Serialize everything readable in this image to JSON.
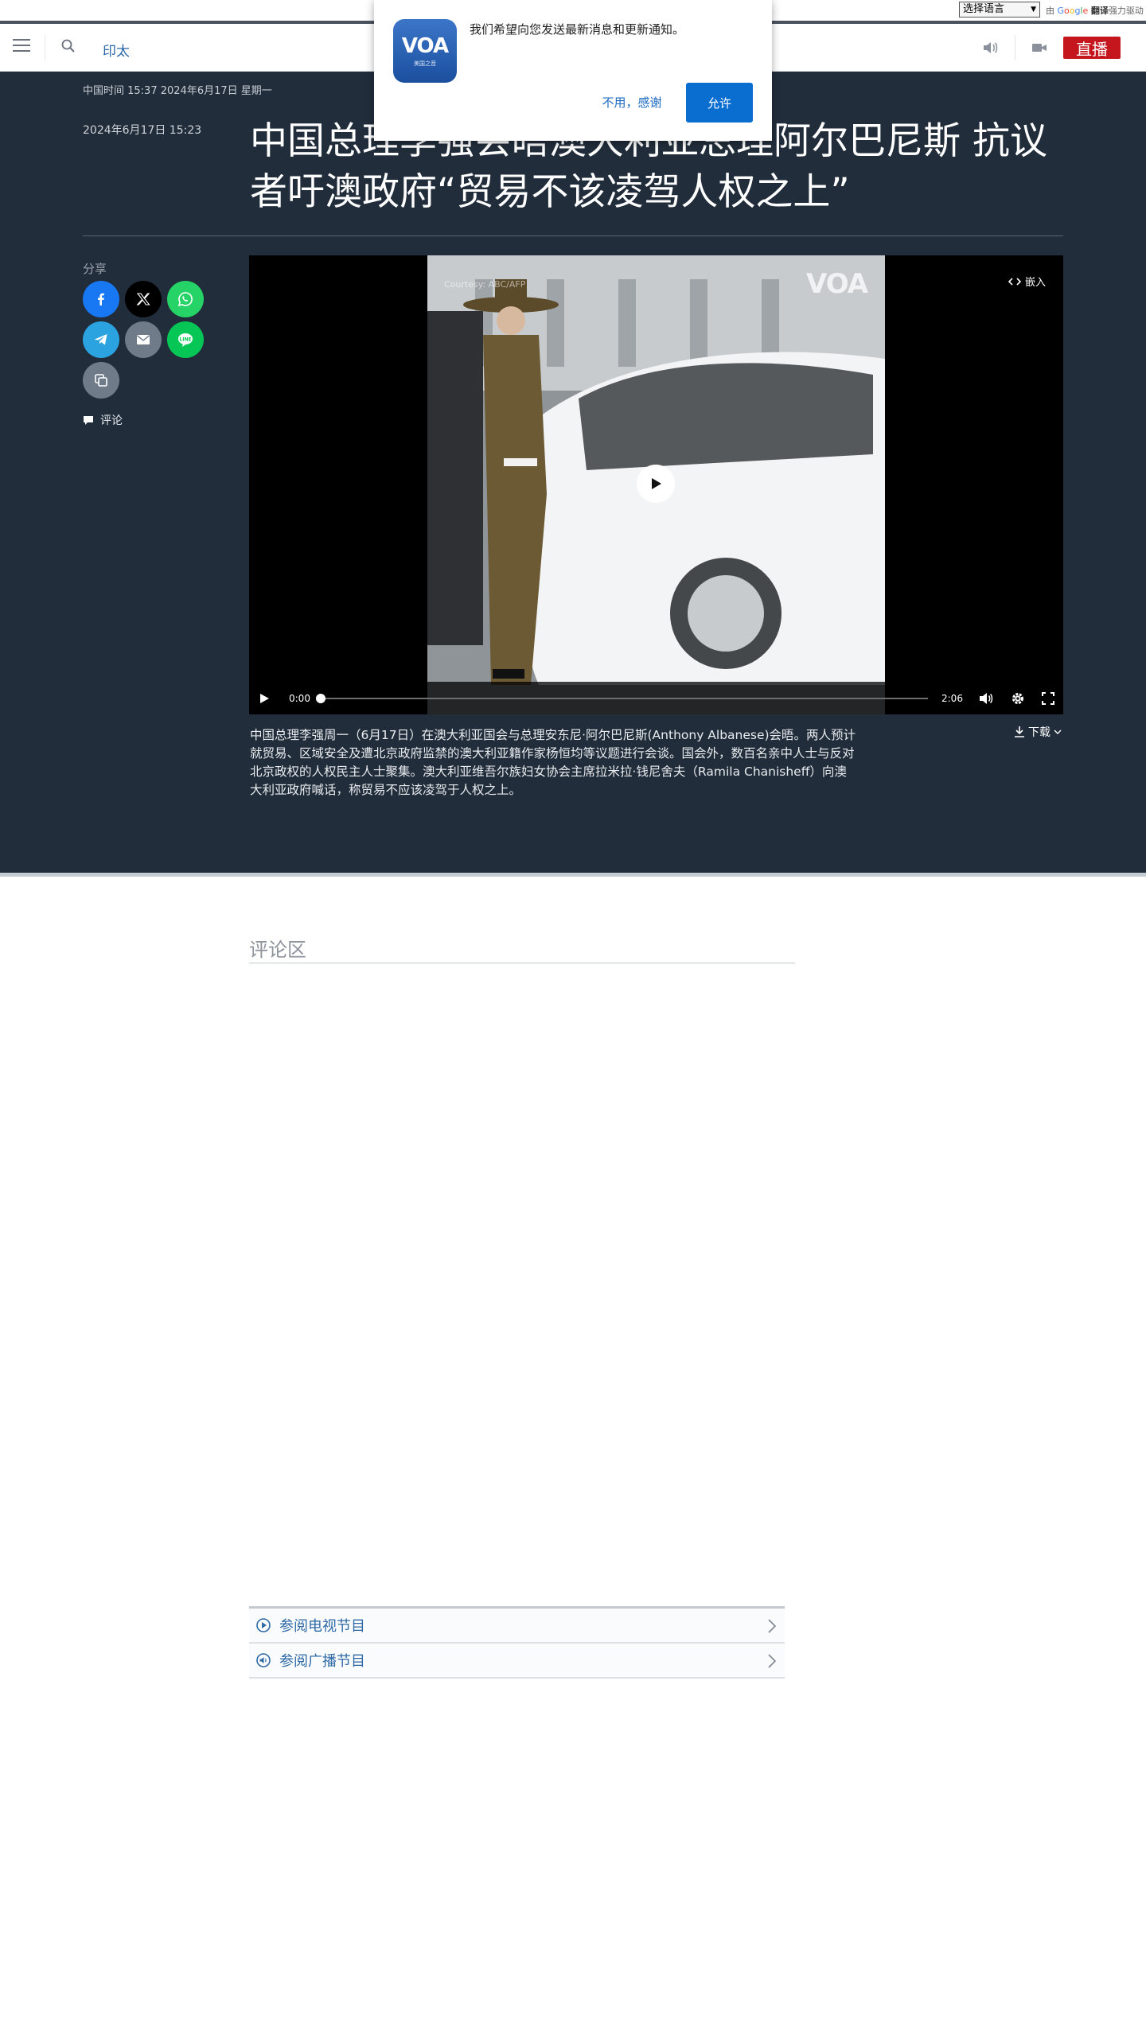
{
  "translate": {
    "select_value": "选择语言",
    "powered_prefix": "由",
    "google": [
      "G",
      "o",
      "o",
      "g",
      "l",
      "e"
    ],
    "powered_word": "翻译",
    "powered_suffix": "强力驱动"
  },
  "header": {
    "section": "印太",
    "live_label": "直播"
  },
  "article": {
    "timebar": "中国时间 15:37 2024年6月17日 星期一",
    "pub_date": "2024年6月17日 15:23",
    "headline": "中国总理李强会晤澳大利亚总理阿尔巴尼斯 抗议者吁澳政府“贸易不该凌驾人权之上”",
    "share_label": "分享",
    "comment_link": "评论",
    "caption": "中国总理李强周一（6月17日）在澳大利亚国会与总理安东尼·阿尔巴尼斯(Anthony Albanese)会晤。两人预计就贸易、区域安全及遭北京政府监禁的澳大利亚籍作家杨恒均等议题进行会谈。国会外，数百名亲中人士与反对北京政权的人权民主人士聚集。澳大利亚维吾尔族妇女协会主席拉米拉·钱尼舍夫（Ramila Chanisheff）向澳大利亚政府喊话，称贸易不应该凌驾于人权之上。"
  },
  "share_buttons": [
    {
      "name": "facebook",
      "color": "#1877f2"
    },
    {
      "name": "x",
      "color": "#000000"
    },
    {
      "name": "whatsapp",
      "color": "#25d366"
    },
    {
      "name": "telegram",
      "color": "#2aa3e0"
    },
    {
      "name": "email",
      "color": "#6f7b89"
    },
    {
      "name": "line",
      "color": "#06c755"
    },
    {
      "name": "copy-link",
      "color": "#6f7b89"
    }
  ],
  "video": {
    "embed_label": "嵌入",
    "current_time": "0:00",
    "duration": "2:06",
    "progress_fraction": 0,
    "watermark": "VOA",
    "courtesy": "Courtesy: ABC/AFP"
  },
  "download_label": "下载",
  "comments": {
    "title": "评论区"
  },
  "programs": [
    {
      "label": "参阅电视节目",
      "icon": "play-circle-icon"
    },
    {
      "label": "参阅广播节目",
      "icon": "audio-circle-icon"
    }
  ],
  "popup": {
    "message": "我们希望向您发送最新消息和更新通知。",
    "deny_label": "不用，感谢",
    "allow_label": "允许",
    "logo_text": "VOA",
    "logo_sub": "美国之音"
  }
}
